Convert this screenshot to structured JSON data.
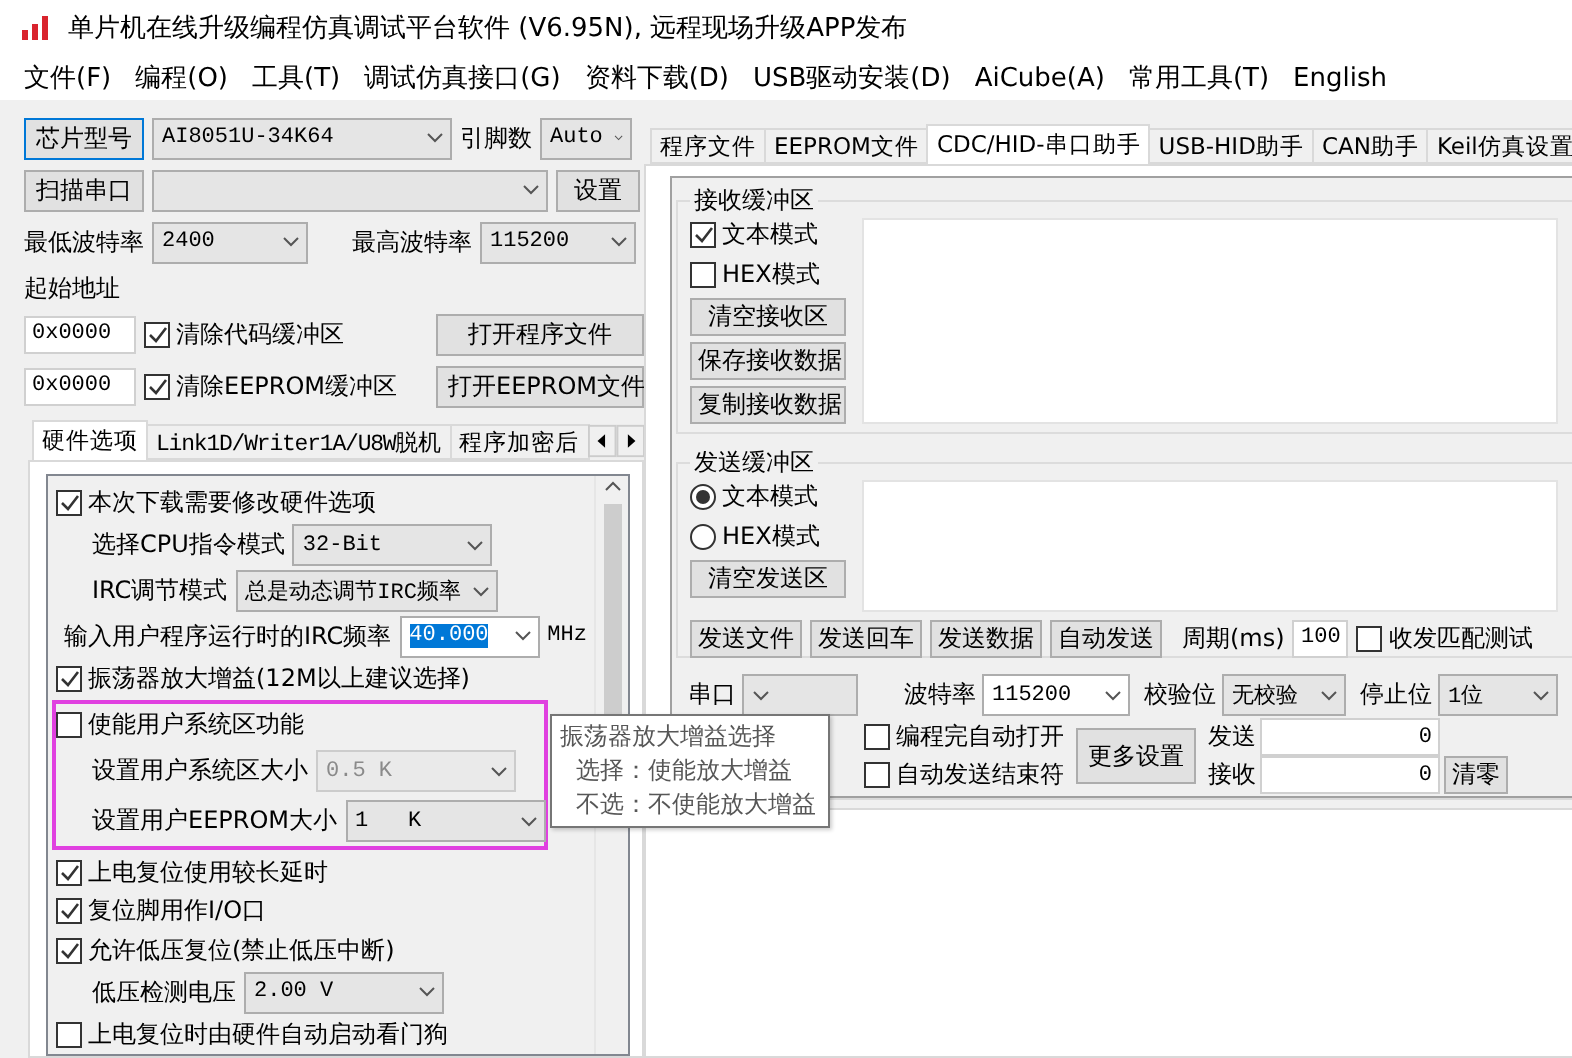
{
  "window": {
    "title": "单片机在线升级编程仿真调试平台软件 (V6.95N), 远程现场升级APP发布"
  },
  "menu": [
    "文件(F)",
    "编程(O)",
    "工具(T)",
    "调试仿真接口(G)",
    "资料下载(D)",
    "USB驱动安装(D)",
    "AiCube(A)",
    "常用工具(T)",
    "English"
  ],
  "chip": {
    "button": "芯片型号",
    "model": "AI8051U-34K64",
    "pins_label": "引脚数",
    "pins": "Auto"
  },
  "port": {
    "button": "扫描串口",
    "settings_button": "设置"
  },
  "baud": {
    "min_label": "最低波特率",
    "min": "2400",
    "max_label": "最高波特率",
    "max": "115200"
  },
  "start_address": {
    "label": "起始地址",
    "rows": [
      {
        "address": "0x0000",
        "label": "清除代码缓冲区",
        "checked": true,
        "button": "打开程序文件"
      },
      {
        "address": "0x0000",
        "label": "清除EEPROM缓冲区",
        "checked": true,
        "button": "打开EEPROM文件"
      }
    ]
  },
  "left_tabs": [
    {
      "label": "硬件选项",
      "selected": true
    },
    {
      "label": "Link1D/Writer1A/U8W脱机",
      "selected": false
    },
    {
      "label": "程序加密后",
      "selected": false
    }
  ],
  "options": [
    {
      "kind": "checkbox",
      "label": "本次下载需要修改硬件选项",
      "checked": true,
      "children": [
        {
          "kind": "select",
          "label": "选择CPU指令模式",
          "value": "32-Bit",
          "disabled": false
        },
        {
          "kind": "select",
          "label": "IRC调节模式",
          "value": "总是动态调节IRC频率",
          "disabled": false
        }
      ]
    },
    {
      "kind": "input",
      "label": "输入用户程序运行时的IRC频率",
      "value": "40.000",
      "text_selected": true,
      "unit": "MHz"
    },
    {
      "kind": "checkbox",
      "label": "振荡器放大增益(12M以上建议选择)",
      "checked": true
    },
    {
      "kind": "checkbox",
      "label": "使能用户系统区功能",
      "checked": false,
      "highlighted": true,
      "children": [
        {
          "kind": "select",
          "label": "设置用户系统区大小",
          "value": "0.5 K",
          "disabled": true
        },
        {
          "kind": "select",
          "label": "设置用户EEPROM大小",
          "value": "1   K",
          "disabled": false
        }
      ]
    },
    {
      "kind": "checkbox",
      "label": "上电复位使用较长延时",
      "checked": true
    },
    {
      "kind": "checkbox",
      "label": "复位脚用作I/O口",
      "checked": true
    },
    {
      "kind": "checkbox",
      "label": "允许低压复位(禁止低压中断)",
      "checked": true,
      "children": [
        {
          "kind": "select",
          "label": "低压检测电压",
          "value": "2.00 V",
          "disabled": false
        }
      ]
    },
    {
      "kind": "checkbox",
      "label": "上电复位时由硬件自动启动看门狗",
      "checked": false
    }
  ],
  "tooltip": {
    "title": "振荡器放大增益选择",
    "lines": [
      "选择：使能放大增益",
      "不选：不使能放大增益"
    ]
  },
  "right_tabs": [
    {
      "label": "程序文件",
      "selected": false
    },
    {
      "label": "EEPROM文件",
      "selected": false
    },
    {
      "label": "CDC/HID-串口助手",
      "selected": true
    },
    {
      "label": "USB-HID助手",
      "selected": false
    },
    {
      "label": "CAN助手",
      "selected": false
    },
    {
      "label": "Keil仿真设置",
      "selected": false
    }
  ],
  "receive": {
    "title": "接收缓冲区",
    "modes": [
      {
        "label": "文本模式",
        "checked": true
      },
      {
        "label": "HEX模式",
        "checked": false
      }
    ],
    "buttons": [
      "清空接收区",
      "保存接收数据",
      "复制接收数据"
    ]
  },
  "send": {
    "title": "发送缓冲区",
    "modes": [
      {
        "label": "文本模式",
        "selected": true
      },
      {
        "label": "HEX模式",
        "selected": false
      }
    ],
    "clear_button": "清空发送区",
    "actions": [
      "发送文件",
      "发送回车",
      "发送数据",
      "自动发送"
    ],
    "period_label": "周期(ms)",
    "period": "100",
    "match_test": {
      "label": "收发匹配测试",
      "checked": false
    }
  },
  "serial": [
    {
      "label": "串口",
      "editable": false
    },
    {
      "label": "波特率",
      "value": "115200",
      "editable": true
    },
    {
      "label": "校验位",
      "value": "无校验",
      "editable": false
    },
    {
      "label": "停止位",
      "value": "1位",
      "editable": false
    }
  ],
  "auto_options": [
    {
      "label": "编程完自动打开",
      "checked": false
    },
    {
      "label": "自动发送结束符",
      "checked": false
    }
  ],
  "more_button": "更多设置",
  "counters": [
    {
      "label": "发送",
      "value": "0"
    },
    {
      "label": "接收",
      "value": "0"
    }
  ],
  "reset_button": "清零"
}
